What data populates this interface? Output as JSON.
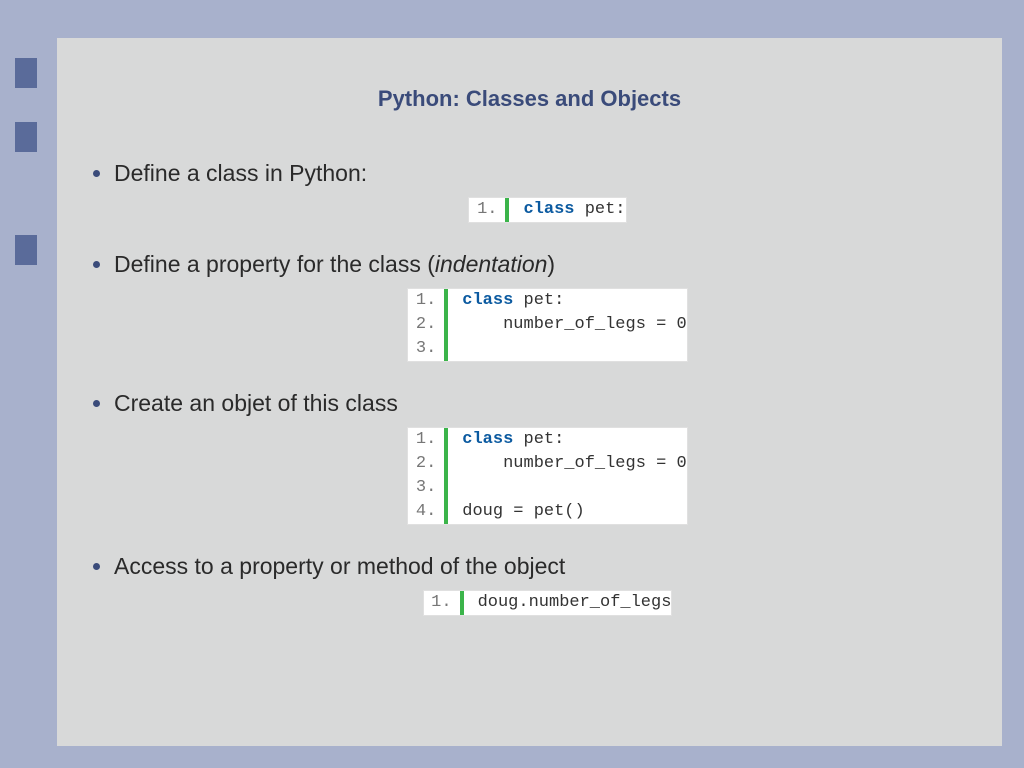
{
  "title": "Python: Classes and Objects",
  "accents": [
    58,
    122,
    235
  ],
  "bullets": [
    {
      "text_pre": "Define a class in Python:",
      "text_italic": "",
      "text_post": "",
      "code": [
        {
          "n": "1.",
          "kw": "class",
          "rest": " pet:"
        }
      ]
    },
    {
      "text_pre": "Define a property for the class (",
      "text_italic": "indentation",
      "text_post": ")",
      "code": [
        {
          "n": "1.",
          "kw": "class",
          "rest": " pet:"
        },
        {
          "n": "2.",
          "kw": "",
          "rest": "    number_of_legs = 0"
        },
        {
          "n": "3.",
          "kw": "",
          "rest": ""
        }
      ]
    },
    {
      "text_pre": "Create an objet of this class",
      "text_italic": "",
      "text_post": "",
      "code": [
        {
          "n": "1.",
          "kw": "class",
          "rest": " pet:"
        },
        {
          "n": "2.",
          "kw": "",
          "rest": "    number_of_legs = 0"
        },
        {
          "n": "3.",
          "kw": "",
          "rest": ""
        },
        {
          "n": "4.",
          "kw": "",
          "rest": "doug = pet()"
        }
      ]
    },
    {
      "text_pre": " Access to a property or method of the object",
      "text_italic": "",
      "text_post": "",
      "code": [
        {
          "n": "1.",
          "kw": "",
          "rest": "doug.number_of_legs"
        }
      ]
    }
  ]
}
